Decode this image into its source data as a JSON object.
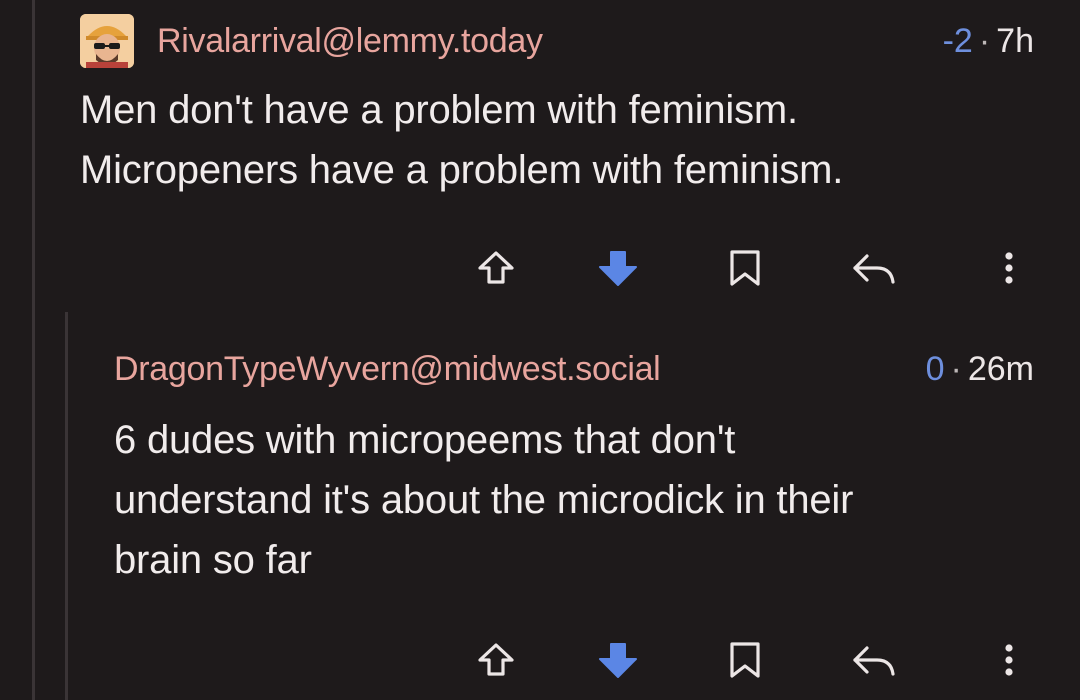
{
  "comments": [
    {
      "username": "Rivalarrival@lemmy.today",
      "score": "-2",
      "separator": "·",
      "time": "7h",
      "lines": [
        "Men don't have a problem with feminism.",
        "Micropeners have a problem with feminism."
      ],
      "vote_state": "downvoted"
    },
    {
      "username": "DragonTypeWyvern@midwest.social",
      "score": "0",
      "separator": "·",
      "time": "26m",
      "lines": [
        "6 dudes with micropeems that don't",
        "understand it's about the microdick in their",
        "brain so far"
      ],
      "vote_state": "downvoted"
    }
  ],
  "colors": {
    "background": "#1e1a1b",
    "username": "#e8a59e",
    "score": "#6e8fdd",
    "downvote_active": "#5b86e5",
    "icon": "#ece6e6"
  },
  "icons": [
    "upvote-icon",
    "downvote-icon",
    "bookmark-icon",
    "reply-icon",
    "more-icon"
  ]
}
